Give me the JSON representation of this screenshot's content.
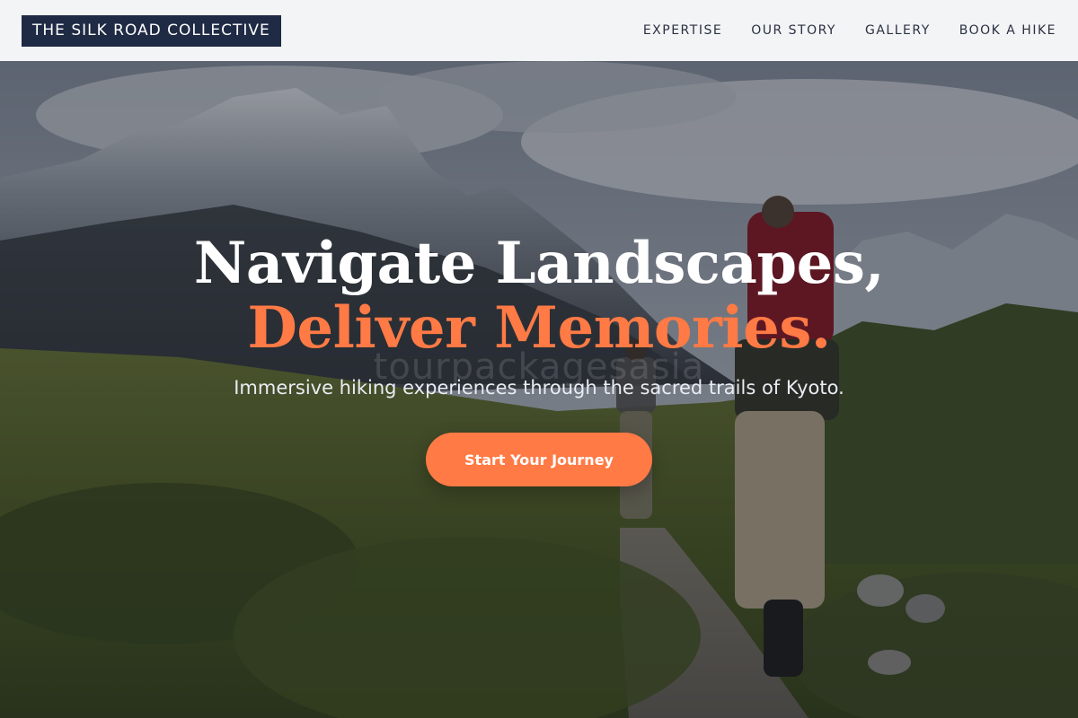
{
  "header": {
    "logo_text": "THE SILK ROAD COLLECTIVE",
    "nav": [
      {
        "label": "EXPERTISE"
      },
      {
        "label": "OUR STORY"
      },
      {
        "label": "GALLERY"
      },
      {
        "label": "BOOK A HIKE"
      }
    ]
  },
  "hero": {
    "headline_line1": "Navigate Landscapes,",
    "headline_line2": "Deliver Memories.",
    "watermark": "tourpackagesasia",
    "subtitle": "Immersive hiking experiences through the sacred trails of Kyoto.",
    "cta_label": "Start Your Journey",
    "background": "mountain-hiking-trail-photo"
  },
  "colors": {
    "accent": "#ff7a45",
    "logo_bg": "#1f2a44",
    "header_bg": "#f3f4f6",
    "nav_text": "#2a3142"
  }
}
